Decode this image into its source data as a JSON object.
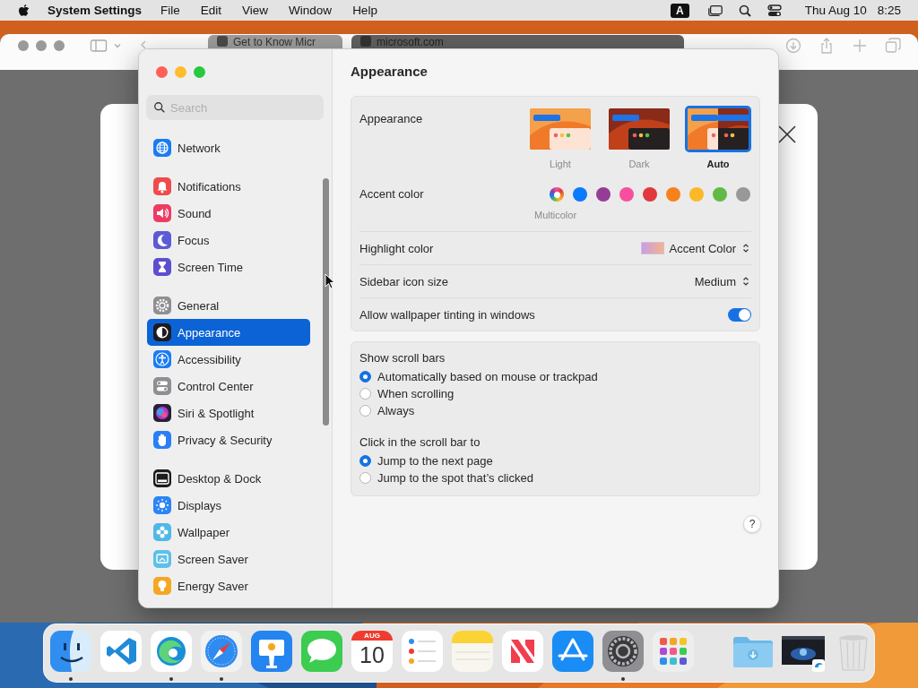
{
  "menu_bar": {
    "app_name": "System Settings",
    "menus": [
      "File",
      "Edit",
      "View",
      "Window",
      "Help"
    ],
    "input_source": "A",
    "date": "Thu Aug 10",
    "time": "8:25"
  },
  "browser": {
    "tabs": [
      {
        "title": "Get to Know Micr",
        "selected": false
      },
      {
        "title": "microsoft.com",
        "selected": true
      }
    ]
  },
  "settings": {
    "search": {
      "placeholder": "Search"
    },
    "sidebar": [
      [
        {
          "label": "Network",
          "kind": "globe",
          "color": "#1a7cf5",
          "selected": false
        }
      ],
      [
        {
          "label": "Notifications",
          "kind": "bell",
          "color": "#ef4b4b",
          "selected": false
        },
        {
          "label": "Sound",
          "kind": "speaker",
          "color": "#ee3b62",
          "selected": false
        },
        {
          "label": "Focus",
          "kind": "moon",
          "color": "#5b5bd6",
          "selected": false
        },
        {
          "label": "Screen Time",
          "kind": "hourglass",
          "color": "#5b4fd0",
          "selected": false
        }
      ],
      [
        {
          "label": "General",
          "kind": "gear",
          "color": "#8e8e93",
          "selected": false
        },
        {
          "label": "Appearance",
          "kind": "contrast",
          "color": "#1c1c1e",
          "selected": true
        },
        {
          "label": "Accessibility",
          "kind": "person",
          "color": "#1a7cf5",
          "selected": false
        },
        {
          "label": "Control Center",
          "kind": "toggles",
          "color": "#8e8e93",
          "selected": false
        },
        {
          "label": "Siri & Spotlight",
          "kind": "orb",
          "color": "#2a2035",
          "selected": false
        },
        {
          "label": "Privacy & Security",
          "kind": "hand",
          "color": "#2a7ff5",
          "selected": false
        }
      ],
      [
        {
          "label": "Desktop & Dock",
          "kind": "dock",
          "color": "#1c1c1e",
          "selected": false
        },
        {
          "label": "Displays",
          "kind": "sun",
          "color": "#2a85f5",
          "selected": false
        },
        {
          "label": "Wallpaper",
          "kind": "flower",
          "color": "#4fb8e8",
          "selected": false
        },
        {
          "label": "Screen Saver",
          "kind": "screen",
          "color": "#5ec0e8",
          "selected": false
        },
        {
          "label": "Energy Saver",
          "kind": "bulb",
          "color": "#f5a623",
          "selected": false
        }
      ]
    ],
    "title": "Appearance",
    "appearance": {
      "label": "Appearance",
      "options": [
        {
          "label": "Light",
          "kind": "light",
          "selected": false
        },
        {
          "label": "Dark",
          "kind": "dark",
          "selected": false
        },
        {
          "label": "Auto",
          "kind": "auto",
          "selected": true
        }
      ]
    },
    "accent": {
      "label": "Accent color",
      "caption": "Multicolor",
      "colors": [
        {
          "kind": "multicolor",
          "selected": true
        },
        {
          "kind": "solid",
          "color": "#0a7aff",
          "selected": false
        },
        {
          "kind": "solid",
          "color": "#953d96",
          "selected": false
        },
        {
          "kind": "solid",
          "color": "#f74f9e",
          "selected": false
        },
        {
          "kind": "solid",
          "color": "#e0383e",
          "selected": false
        },
        {
          "kind": "solid",
          "color": "#f7821b",
          "selected": false
        },
        {
          "kind": "solid",
          "color": "#fcb827",
          "selected": false
        },
        {
          "kind": "solid",
          "color": "#62ba46",
          "selected": false
        },
        {
          "kind": "solid",
          "color": "#989898",
          "selected": false
        }
      ]
    },
    "highlight": {
      "label": "Highlight color",
      "value": "Accent Color"
    },
    "icon_size": {
      "label": "Sidebar icon size",
      "value": "Medium"
    },
    "tinting": {
      "label": "Allow wallpaper tinting in windows",
      "on": true
    },
    "scroll_bars": {
      "title": "Show scroll bars",
      "options": [
        {
          "label": "Automatically based on mouse or trackpad",
          "selected": true
        },
        {
          "label": "When scrolling",
          "selected": false
        },
        {
          "label": "Always",
          "selected": false
        }
      ]
    },
    "click_scroll": {
      "title": "Click in the scroll bar to",
      "options": [
        {
          "label": "Jump to the next page",
          "selected": true
        },
        {
          "label": "Jump to the spot that’s clicked",
          "selected": false
        }
      ]
    },
    "help": "?"
  },
  "dock": {
    "apps": [
      {
        "kind": "finder",
        "running": true
      },
      {
        "kind": "code-editor",
        "running": false
      },
      {
        "kind": "wave-browser",
        "running": true
      },
      {
        "kind": "compass",
        "running": true
      },
      {
        "kind": "podium",
        "running": false
      },
      {
        "kind": "speech-bubble",
        "running": false
      },
      {
        "kind": "calendar",
        "month": "AUG",
        "day": "10",
        "running": false
      },
      {
        "kind": "checklist",
        "running": false
      },
      {
        "kind": "notepad",
        "running": false
      },
      {
        "kind": "news",
        "running": false
      },
      {
        "kind": "app-store",
        "running": false
      },
      {
        "kind": "gear",
        "running": true
      },
      {
        "kind": "app-grid",
        "running": false
      }
    ],
    "others": [
      {
        "kind": "downloads-folder"
      },
      {
        "kind": "window-thumbnail"
      },
      {
        "kind": "trash"
      }
    ]
  }
}
